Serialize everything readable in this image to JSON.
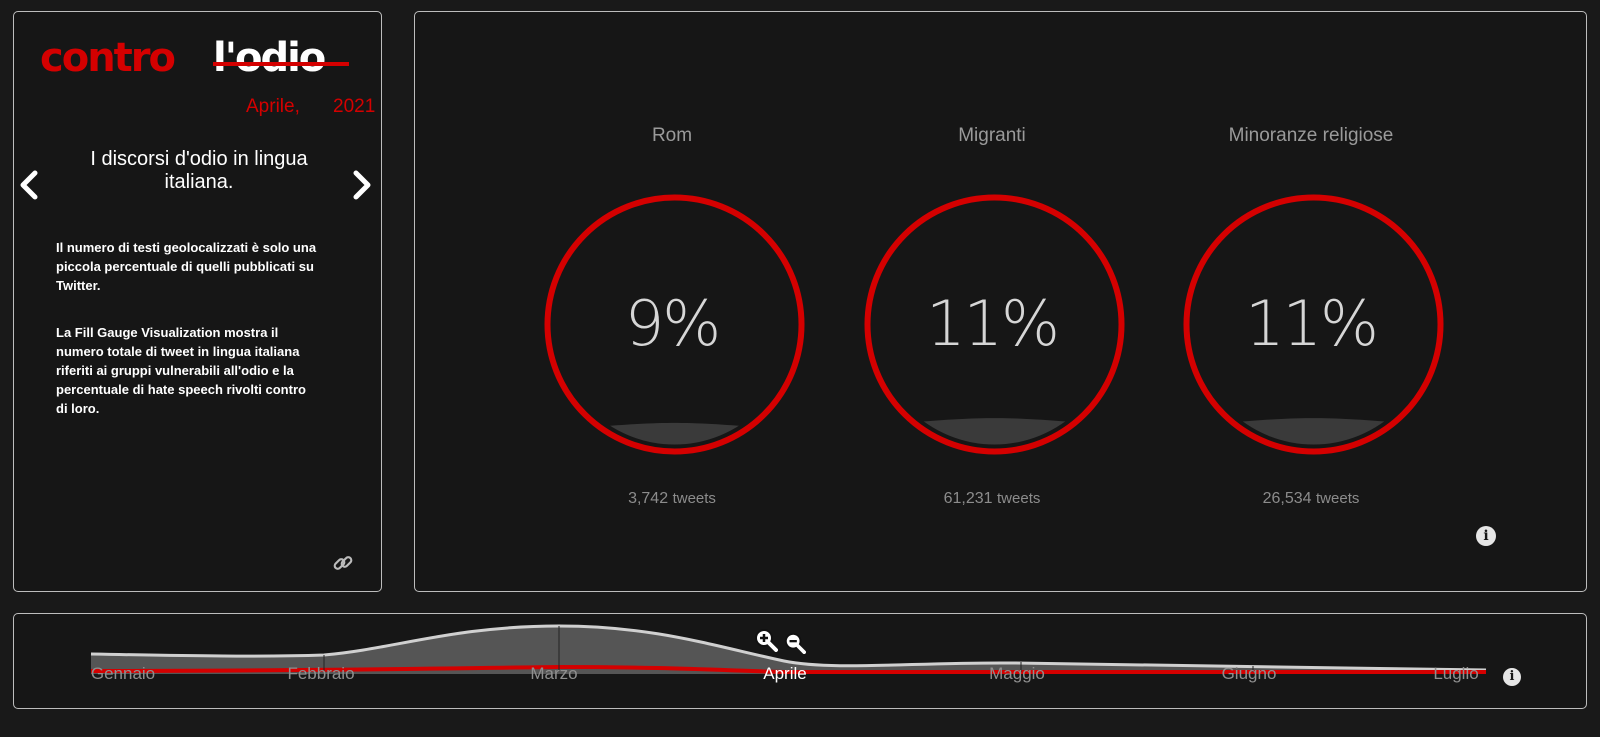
{
  "logo": {
    "word1": "contro",
    "word2": "l'odio",
    "month": "Aprile,",
    "year": "2021"
  },
  "sidebar": {
    "prev_icon": "chevron-left-icon",
    "next_icon": "chevron-right-icon",
    "title": "I discorsi d'odio in lingua italiana.",
    "paragraph1": "Il numero di testi geolocalizzati è solo una piccola percentuale di quelli pubblicati su Twitter.",
    "paragraph2": "La Fill Gauge Visualization mostra il numero totale di tweet in lingua italiana riferiti ai gruppi vulnerabili all'odio e la percentuale di hate speech rivolti contro di loro.",
    "link_icon": "link-icon"
  },
  "gauges": [
    {
      "title": "Rom",
      "percent_label": "9%",
      "fill": 0.09,
      "count": "3,742",
      "unit": "tweets"
    },
    {
      "title": "Migranti",
      "percent_label": "11%",
      "fill": 0.11,
      "count": "61,231",
      "unit": "tweets"
    },
    {
      "title": "Minoranze religiose",
      "percent_label": "11%",
      "fill": 0.11,
      "count": "26,534",
      "unit": "tweets"
    }
  ],
  "gauge_info_icon": "info-icon",
  "timeline": {
    "months": [
      "Gennaio",
      "Febbraio",
      "Marzo",
      "Aprile",
      "Maggio",
      "Giugno",
      "Luglio"
    ],
    "selected": "Aprile",
    "zoom_in_icon": "zoom-in-icon",
    "zoom_out_icon": "zoom-out-icon",
    "info_icon": "info-icon"
  },
  "colors": {
    "accent": "#d40000",
    "background": "#191919",
    "panel_border": "#bdbdbd",
    "gauge_fill": "#3a3a3a",
    "area_fill": "#555555"
  }
}
